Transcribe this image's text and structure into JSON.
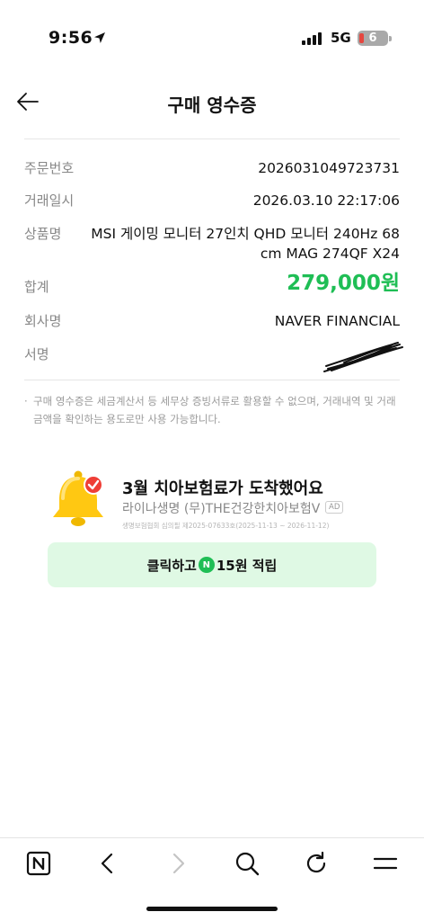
{
  "status_bar": {
    "time": "9:56",
    "network": "5G",
    "battery": "6"
  },
  "header": {
    "title": "구매 영수증"
  },
  "receipt": {
    "order_number_label": "주문번호",
    "order_number": "2026031049723731",
    "trade_date_label": "거래일시",
    "trade_date": "2026.03.10 22:17:06",
    "product_label": "상품명",
    "product_line1": "MSI 게이밍 모니터 27인치 QHD 모니터 240Hz 68",
    "product_line2": "cm MAG 274QF X24",
    "total_label": "합계",
    "total": "279,000원",
    "company_label": "회사명",
    "company": "NAVER FINANCIAL",
    "signature_label": "서명"
  },
  "notice": {
    "text": "구매 영수증은 세금계산서 등 세무상 증빙서류로 활용할 수 없으며, 거래내역 및 거래금액을 확인하는 용도로만 사용 가능합니다."
  },
  "ad": {
    "title": "3월 치아보험료가 도착했어요",
    "subtitle": "라이나생명 (무)THE건강한치아보험V",
    "badge": "AD",
    "fine_print": "생명보험협회 심의필 제2025-07633호(2025-11-13 ~ 2026-11-12)",
    "button_prefix": "클릭하고",
    "coin_symbol": "N",
    "button_suffix": "15원 적립"
  },
  "colors": {
    "accent_green": "#1fbe55",
    "ad_button_bg": "#dff9e4"
  },
  "toolbar": {
    "items": [
      "naver-home-icon",
      "back-icon",
      "forward-icon",
      "search-icon",
      "refresh-icon",
      "menu-icon"
    ]
  }
}
